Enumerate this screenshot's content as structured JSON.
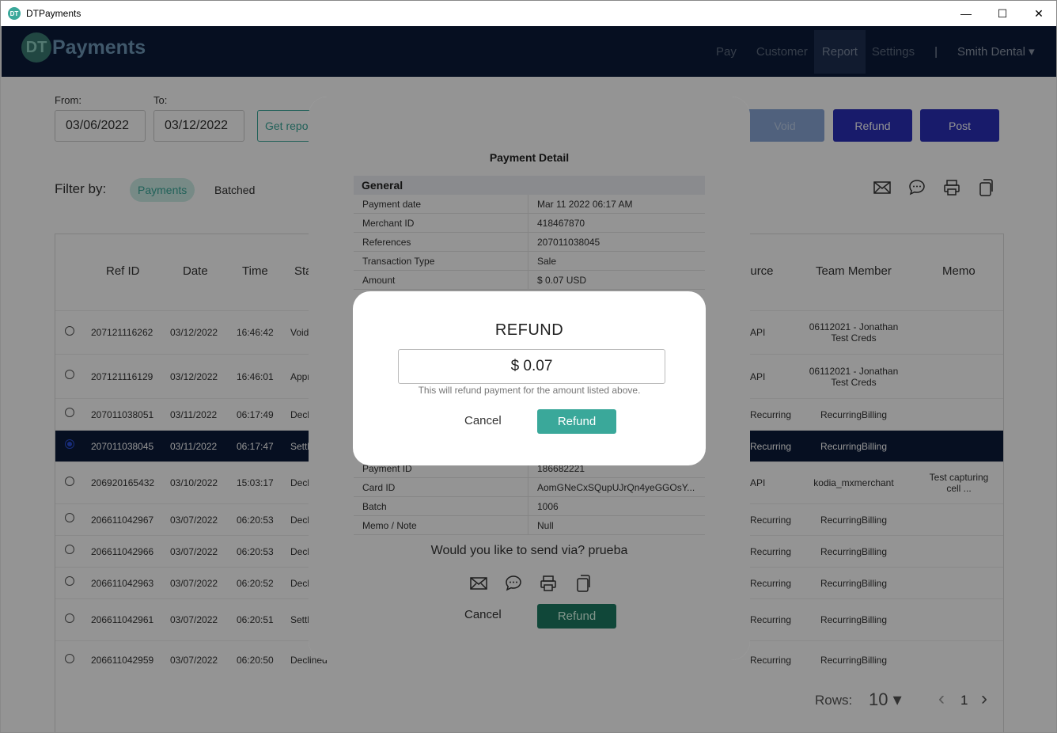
{
  "window": {
    "title": "DTPayments",
    "icon_text": "DT"
  },
  "header": {
    "logo_dt": "DT",
    "logo_name": "Payments",
    "nav": [
      {
        "label": "Pay"
      },
      {
        "label": "Customer"
      },
      {
        "label": "Report",
        "active": true
      },
      {
        "label": "Settings"
      }
    ],
    "user": "Smith Dental ▾"
  },
  "report": {
    "from_label": "From:",
    "to_label": "To:",
    "from_value": "03/06/2022",
    "to_value": "03/12/2022",
    "get_report": "Get report",
    "void_label": "Void",
    "refund_label": "Refund",
    "post_label": "Post",
    "filter_label": "Filter by:",
    "filter_payments": "Payments",
    "filter_batched": "Batched"
  },
  "table": {
    "headers": [
      "Ref ID",
      "Date",
      "Time",
      "Status",
      "Source",
      "Team Member",
      "Memo"
    ],
    "rows": [
      {
        "ref": "207121116262",
        "date": "03/12/2022",
        "time": "16:46:42",
        "status": "Voided",
        "source": "API",
        "member": "06112021 - Jonathan Test Creds",
        "memo": ""
      },
      {
        "ref": "207121116129",
        "date": "03/12/2022",
        "time": "16:46:01",
        "status": "Approved",
        "source": "API",
        "member": "06112021 - Jonathan Test Creds",
        "memo": ""
      },
      {
        "ref": "207011038051",
        "date": "03/11/2022",
        "time": "06:17:49",
        "status": "Declined",
        "source": "Recurring",
        "member": "RecurringBilling",
        "memo": ""
      },
      {
        "ref": "207011038045",
        "date": "03/11/2022",
        "time": "06:17:47",
        "status": "Settled",
        "source": "Recurring",
        "member": "RecurringBilling",
        "memo": "",
        "selected": true
      },
      {
        "ref": "206920165432",
        "date": "03/10/2022",
        "time": "15:03:17",
        "status": "Declined",
        "source": "API",
        "member": "kodia_mxmerchant",
        "memo": "Test capturing cell ..."
      },
      {
        "ref": "206611042967",
        "date": "03/07/2022",
        "time": "06:20:53",
        "status": "Declined",
        "source": "Recurring",
        "member": "RecurringBilling",
        "memo": ""
      },
      {
        "ref": "206611042966",
        "date": "03/07/2022",
        "time": "06:20:53",
        "status": "Declined",
        "source": "Recurring",
        "member": "RecurringBilling",
        "memo": ""
      },
      {
        "ref": "206611042963",
        "date": "03/07/2022",
        "time": "06:20:52",
        "status": "Declined",
        "source": "Recurring",
        "member": "RecurringBilling",
        "memo": ""
      },
      {
        "ref": "206611042961",
        "date": "03/07/2022",
        "time": "06:20:51",
        "status": "Settled",
        "source": "Recurring",
        "member": "RecurringBilling",
        "memo": ""
      },
      {
        "ref": "206611042959",
        "date": "03/07/2022",
        "time": "06:20:50",
        "status": "Declined",
        "source": "Recurring",
        "member": "RecurringBilling",
        "memo": ""
      }
    ]
  },
  "pagination": {
    "rows_label": "Rows:",
    "rows_value": "10 ▾",
    "page": "1",
    "prev": "‹",
    "next": "›"
  },
  "detail": {
    "title": "Payment Detail",
    "general_label": "General",
    "general": [
      {
        "k": "Payment date",
        "v": "Mar 11 2022 06:17 AM"
      },
      {
        "k": "Merchant ID",
        "v": "418467870"
      },
      {
        "k": "References",
        "v": "207011038045"
      },
      {
        "k": "Transaction Type",
        "v": "Sale"
      },
      {
        "k": "Amount",
        "v": "$ 0.07 USD"
      }
    ],
    "more": [
      {
        "k": "Payment ID",
        "v": "186682221"
      },
      {
        "k": "Card ID",
        "v": "AomGNeCxSQupUJrQn4yeGGOsY..."
      },
      {
        "k": "Batch",
        "v": "1006"
      },
      {
        "k": "Memo / Note",
        "v": "Null"
      }
    ],
    "send_question": "Would you like to send via? prueba",
    "cancel": "Cancel",
    "refund": "Refund"
  },
  "refund_dialog": {
    "title": "REFUND",
    "amount": "$ 0.07",
    "hint": "This will refund payment for the amount listed above.",
    "cancel": "Cancel",
    "refund": "Refund"
  },
  "colors": {
    "header_bg": "#0c1b3a",
    "accent": "#3aa89a",
    "primary_btn": "#2a2fb8"
  }
}
